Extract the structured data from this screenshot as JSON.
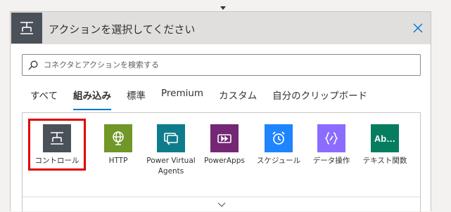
{
  "dialog": {
    "title": "アクションを選択してください",
    "header_icon": "control-icon",
    "close_icon": "close-icon"
  },
  "search": {
    "placeholder": "コネクタとアクションを検索する",
    "value": ""
  },
  "tabs": [
    {
      "label": "すべて",
      "active": false
    },
    {
      "label": "組み込み",
      "active": true
    },
    {
      "label": "標準",
      "active": false
    },
    {
      "label": "Premium",
      "active": false
    },
    {
      "label": "カスタム",
      "active": false
    },
    {
      "label": "自分のクリップボード",
      "active": false
    }
  ],
  "connectors": [
    {
      "label": "コントロール",
      "color": "#4a5158",
      "icon": "control-icon",
      "selected": true
    },
    {
      "label": "HTTP",
      "color": "#709727",
      "icon": "globe-icon",
      "selected": false
    },
    {
      "label": "Power Virtual Agents",
      "color": "#0f7c8c",
      "icon": "power-virtual-agents-icon",
      "selected": false
    },
    {
      "label": "PowerApps",
      "color": "#742774",
      "icon": "powerapps-icon",
      "selected": false
    },
    {
      "label": "スケジュール",
      "color": "#1f85ff",
      "icon": "alarm-clock-icon",
      "selected": false
    },
    {
      "label": "データ操作",
      "color": "#8c6cff",
      "icon": "data-operation-icon",
      "selected": false
    },
    {
      "label": "テキスト関数",
      "color": "#067d5e",
      "icon": "text-functions-icon",
      "icon_text": "Ab…",
      "selected": false
    }
  ],
  "colors": {
    "accent": "#0078d4",
    "selection": "#e00000"
  }
}
